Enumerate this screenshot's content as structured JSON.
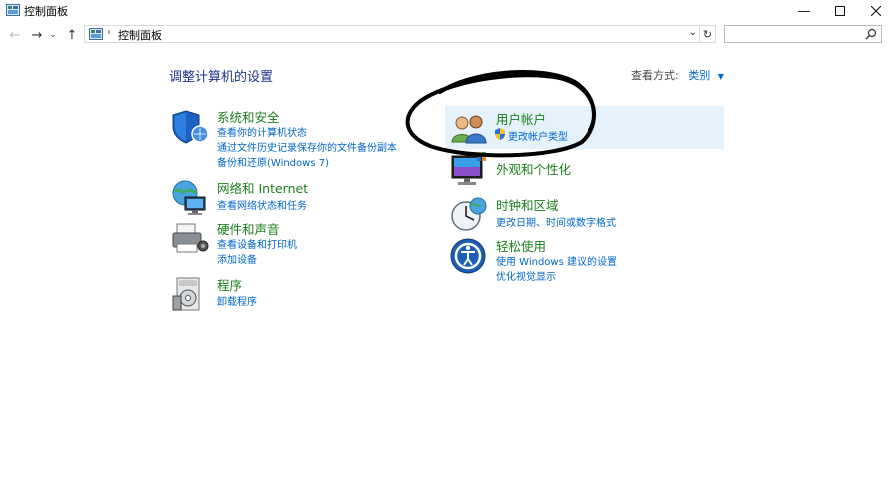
{
  "window": {
    "title": "控制面板"
  },
  "address": {
    "path": "控制面板",
    "search_placeholder": ""
  },
  "content": {
    "heading": "调整计算机的设置",
    "view_by_label": "查看方式:",
    "view_by_value": "类别"
  },
  "categories": {
    "system": {
      "title": "系统和安全",
      "links": [
        "查看你的计算机状态",
        "通过文件历史记录保存你的文件备份副本",
        "备份和还原(Windows 7)"
      ]
    },
    "network": {
      "title": "网络和 Internet",
      "links": [
        "查看网络状态和任务"
      ]
    },
    "hardware": {
      "title": "硬件和声音",
      "links": [
        "查看设备和打印机",
        "添加设备"
      ]
    },
    "programs": {
      "title": "程序",
      "links": [
        "卸载程序"
      ]
    },
    "users": {
      "title": "用户帐户",
      "links": [
        "更改帐户类型"
      ]
    },
    "appearance": {
      "title": "外观和个性化",
      "links": []
    },
    "clock": {
      "title": "时钟和区域",
      "links": [
        "更改日期、时间或数字格式"
      ]
    },
    "ease": {
      "title": "轻松使用",
      "links": [
        "使用 Windows 建议的设置",
        "优化视觉显示"
      ]
    }
  },
  "colors": {
    "category_title": "#1b7f1b",
    "link": "#0066cc",
    "heading": "#1e3287",
    "highlight": "#e5f1fb"
  }
}
